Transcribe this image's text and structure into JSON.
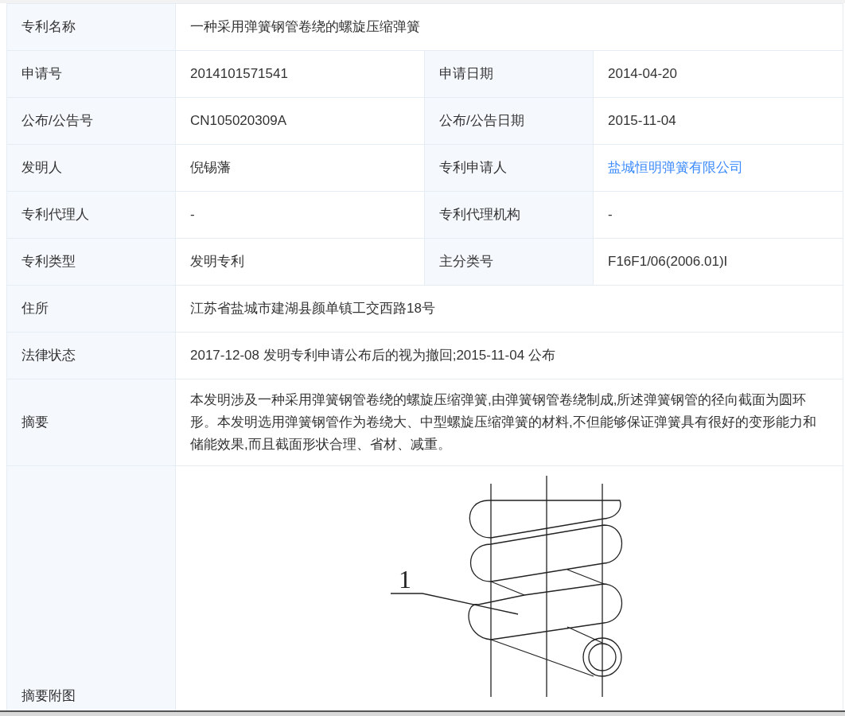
{
  "rows": [
    {
      "fields": [
        {
          "label": "专利名称",
          "value": "一种采用弹簧钢管卷绕的螺旋压缩弹簧",
          "link": false
        }
      ]
    },
    {
      "fields": [
        {
          "label": "申请号",
          "value": "2014101571541",
          "link": false
        },
        {
          "label": "申请日期",
          "value": "2014-04-20",
          "link": false
        }
      ]
    },
    {
      "fields": [
        {
          "label": "公布/公告号",
          "value": "CN105020309A",
          "link": false
        },
        {
          "label": "公布/公告日期",
          "value": "2015-11-04",
          "link": false
        }
      ]
    },
    {
      "fields": [
        {
          "label": "发明人",
          "value": "倪锡藩",
          "link": false
        },
        {
          "label": "专利申请人",
          "value": "盐城恒明弹簧有限公司",
          "link": true
        }
      ]
    },
    {
      "fields": [
        {
          "label": "专利代理人",
          "value": "-",
          "link": false
        },
        {
          "label": "专利代理机构",
          "value": "-",
          "link": false
        }
      ]
    },
    {
      "fields": [
        {
          "label": "专利类型",
          "value": "发明专利",
          "link": false
        },
        {
          "label": "主分类号",
          "value": "F16F1/06(2006.01)I",
          "link": false
        }
      ]
    },
    {
      "fields": [
        {
          "label": "住所",
          "value": "江苏省盐城市建湖县颜单镇工交西路18号",
          "link": false
        }
      ]
    },
    {
      "fields": [
        {
          "label": "法律状态",
          "value": "2017-12-08 发明专利申请公布后的视为撤回;2015-11-04 公布",
          "link": false
        }
      ]
    },
    {
      "fields": [
        {
          "label": "摘要",
          "value": "本发明涉及一种采用弹簧钢管卷绕的螺旋压缩弹簧,由弹簧钢管卷绕制成,所述弹簧钢管的径向截面为圆环形。本发明选用弹簧钢管作为卷绕大、中型螺旋压缩弹簧的材料,不但能够保证弹簧具有很好的变形能力和储能效果,而且截面形状合理、省材、减重。",
          "link": false
        }
      ]
    }
  ],
  "figure": {
    "label": "摘要附图",
    "callout": "1"
  }
}
